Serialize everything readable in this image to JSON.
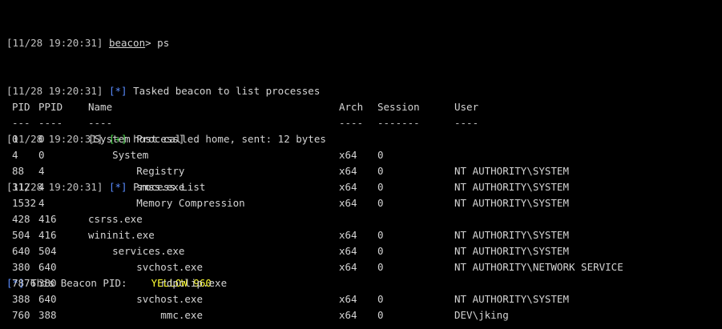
{
  "console": {
    "lines": [
      {
        "timestamp": "[11/28 19:20:31]",
        "prompt_user": "beacon",
        "prompt_suffix": "> ",
        "command": "ps"
      },
      {
        "timestamp": "[11/28 19:20:31]",
        "marker": "[*]",
        "text": "Tasked beacon to list processes"
      },
      {
        "timestamp": "[11/28 19:20:31]",
        "marker": "[+]",
        "text": "host called home, sent: 12 bytes"
      },
      {
        "timestamp": "[11/28 19:20:31]",
        "marker": "[*]",
        "text": "Process List"
      }
    ],
    "pid_line": {
      "marker": "[*]",
      "label": "This Beacon PID:",
      "value": "YELLOW 960"
    }
  },
  "process_table": {
    "headers": {
      "pid": "PID",
      "ppid": "PPID",
      "name": "Name",
      "arch": "Arch",
      "session": "Session",
      "user": "User"
    },
    "separators": {
      "pid": "---",
      "ppid": "----",
      "name": "----",
      "arch": "----",
      "session": "-------",
      "user": "----"
    },
    "rows": [
      {
        "pid": "0",
        "ppid": "0",
        "name": "[System Process]",
        "arch": "",
        "session": "",
        "user": ""
      },
      {
        "pid": "4",
        "ppid": "0",
        "name": "    System",
        "arch": "x64",
        "session": "0",
        "user": ""
      },
      {
        "pid": "88",
        "ppid": "4",
        "name": "        Registry",
        "arch": "x64",
        "session": "0",
        "user": "NT AUTHORITY\\SYSTEM"
      },
      {
        "pid": "312",
        "ppid": "4",
        "name": "        smss.exe",
        "arch": "x64",
        "session": "0",
        "user": "NT AUTHORITY\\SYSTEM"
      },
      {
        "pid": "1532",
        "ppid": "4",
        "name": "        Memory Compression",
        "arch": "x64",
        "session": "0",
        "user": "NT AUTHORITY\\SYSTEM"
      },
      {
        "pid": "428",
        "ppid": "416",
        "name": "csrss.exe",
        "arch": "",
        "session": "",
        "user": ""
      },
      {
        "pid": "504",
        "ppid": "416",
        "name": "wininit.exe",
        "arch": "x64",
        "session": "0",
        "user": "NT AUTHORITY\\SYSTEM"
      },
      {
        "pid": "640",
        "ppid": "504",
        "name": "    services.exe",
        "arch": "x64",
        "session": "0",
        "user": "NT AUTHORITY\\SYSTEM"
      },
      {
        "pid": "380",
        "ppid": "640",
        "name": "        svchost.exe",
        "arch": "x64",
        "session": "0",
        "user": "NT AUTHORITY\\NETWORK SERVICE"
      },
      {
        "pid": "7876",
        "ppid": "380",
        "name": "            rdpclip.exe",
        "arch": "",
        "session": "",
        "user": ""
      },
      {
        "pid": "388",
        "ppid": "640",
        "name": "        svchost.exe",
        "arch": "x64",
        "session": "0",
        "user": "NT AUTHORITY\\SYSTEM"
      },
      {
        "pid": "760",
        "ppid": "388",
        "name": "            mmc.exe",
        "arch": "x64",
        "session": "0",
        "user": "DEV\\jking"
      }
    ]
  }
}
